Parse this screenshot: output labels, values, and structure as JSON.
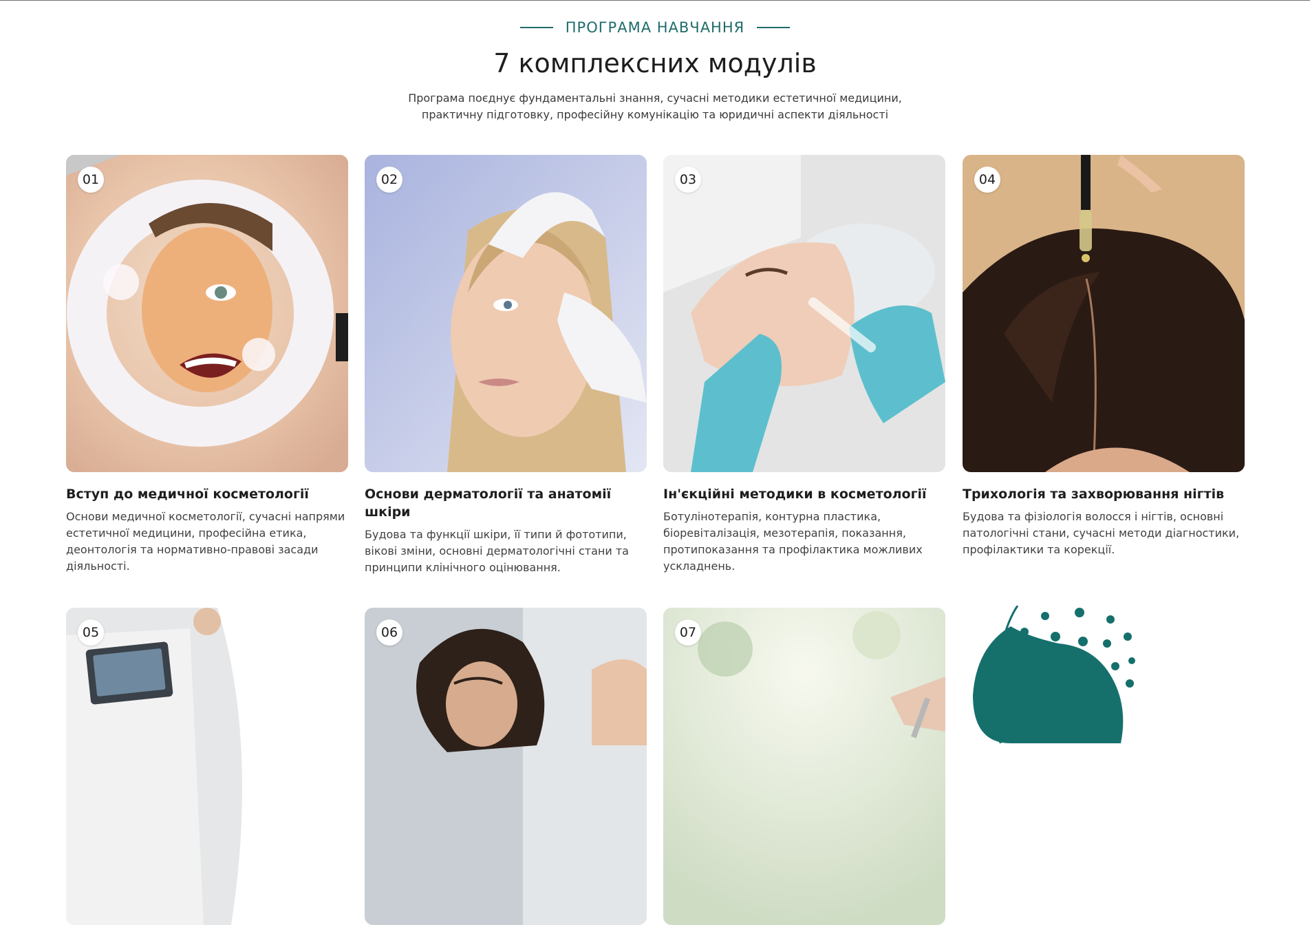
{
  "header": {
    "eyebrow": "ПРОГРАМА НАВЧАННЯ",
    "title": "7 комплексних модулів",
    "subtitle": "Програма поєднує фундаментальні знання, сучасні методики естетичної медицини, практичну підготовку, професійну комунікацію та юридичні аспекти діяльності"
  },
  "modules": [
    {
      "number": "01",
      "title": "Вступ до медичної косметології",
      "description": "Основи медичної косметології, сучасні напрями естетичної медицини, професійна етика, деонтологія та нормативно-правові засади діяльності."
    },
    {
      "number": "02",
      "title": "Основи дерматології та анатомії шкіри",
      "description": "Будова та функції шкіри, її типи й фототипи, вікові зміни, основні дерматологічні стани та принципи клінічного оцінювання."
    },
    {
      "number": "03",
      "title": "Ін'єкційні методики в косметології",
      "description": "Ботулінотерапія, контурна пластика, біоревіталізація, мезотерапія, показання, протипоказання та профілактика можливих ускладнень."
    },
    {
      "number": "04",
      "title": "Трихологія та захворювання нігтів",
      "description": "Будова та фізіологія волосся і нігтів, основні патологічні стани, сучасні методи діагностики, профілактики та корекції."
    },
    {
      "number": "05"
    },
    {
      "number": "06"
    },
    {
      "number": "07"
    }
  ],
  "colors": {
    "accent": "#1f6b6b",
    "decor": "#15706c"
  }
}
